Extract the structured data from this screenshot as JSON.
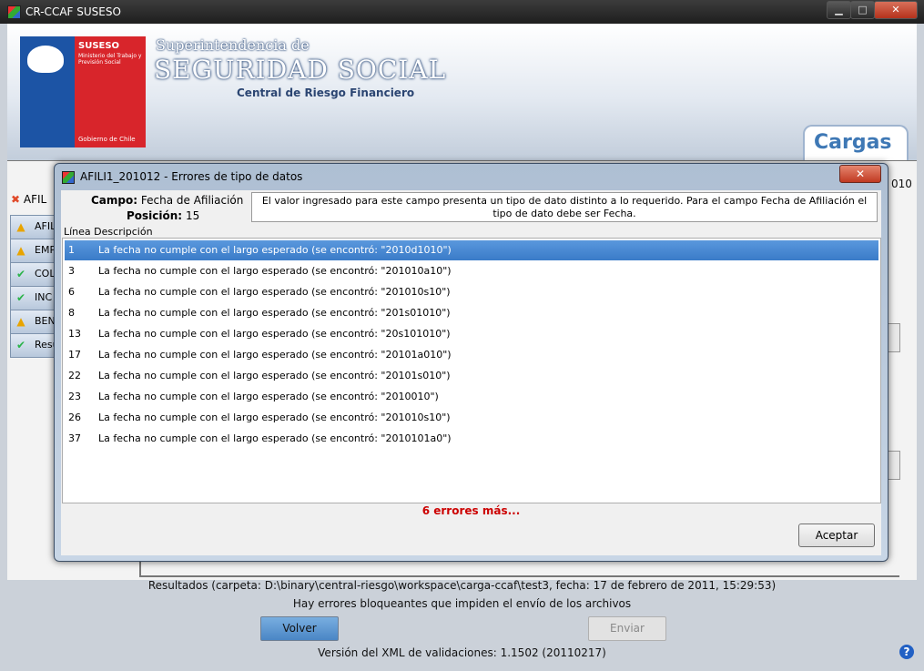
{
  "window": {
    "title": "CR-CCAF SUSESO",
    "minimize": "▁",
    "maximize": "□",
    "close": "✕"
  },
  "logo": {
    "name": "SUSESO",
    "sub": "Ministerio del Trabajo y Previsión Social",
    "footer": "Gobierno de Chile"
  },
  "header": {
    "line1": "Superintendencia de",
    "line2": "SEGURIDAD SOCIAL",
    "line3": "Central de Riesgo Financiero",
    "section_tab": "Cargas"
  },
  "background": {
    "file_tab": "AFIL",
    "side_tabs": [
      {
        "icon": "warning-icon",
        "label": "AFIL"
      },
      {
        "icon": "warning-icon",
        "label": "EMP"
      },
      {
        "icon": "check-icon",
        "label": "COL"
      },
      {
        "icon": "check-icon",
        "label": "INC"
      },
      {
        "icon": "warning-icon",
        "label": "BEN"
      },
      {
        "icon": "check-icon",
        "label": "Resu"
      }
    ],
    "right_frag": "010",
    "results_text": "Resultados (carpeta: D:\\binary\\central-riesgo\\workspace\\carga-ccaf\\test3, fecha: 17 de febrero de 2011, 15:29:53)",
    "errors_text": "Hay errores bloqueantes que impiden el envío de los archivos",
    "volver": "Volver",
    "enviar": "Enviar",
    "version": "Versión del XML de validaciones: 1.1502 (20110217)",
    "help": "?"
  },
  "dialog": {
    "title": "AFILI1_201012 - Errores de tipo de datos",
    "close": "✕",
    "campo_label": "Campo:",
    "campo_value": "Fecha de Afiliación",
    "posicion_label": "Posición:",
    "posicion_value": "15",
    "message": "El valor ingresado para este campo presenta un tipo de dato distinto a lo requerido. Para el campo Fecha de Afiliación el tipo de dato debe ser Fecha.",
    "col_linea": "Línea",
    "col_descripcion": "Descripción",
    "rows": [
      {
        "linea": "1",
        "desc": "La fecha no cumple con el largo esperado (se encontró: \"2010d1010\")"
      },
      {
        "linea": "3",
        "desc": "La fecha no cumple con el largo esperado (se encontró: \"201010a10\")"
      },
      {
        "linea": "6",
        "desc": "La fecha no cumple con el largo esperado (se encontró: \"201010s10\")"
      },
      {
        "linea": "8",
        "desc": "La fecha no cumple con el largo esperado (se encontró: \"201s01010\")"
      },
      {
        "linea": "13",
        "desc": "La fecha no cumple con el largo esperado (se encontró: \"20s101010\")"
      },
      {
        "linea": "17",
        "desc": "La fecha no cumple con el largo esperado (se encontró: \"20101a010\")"
      },
      {
        "linea": "22",
        "desc": "La fecha no cumple con el largo esperado (se encontró: \"20101s010\")"
      },
      {
        "linea": "23",
        "desc": "La fecha no cumple con el largo esperado (se encontró: \"2010010\")"
      },
      {
        "linea": "26",
        "desc": "La fecha no cumple con el largo esperado (se encontró: \"201010s10\")"
      },
      {
        "linea": "37",
        "desc": "La fecha no cumple con el largo esperado (se encontró: \"2010101a0\")"
      }
    ],
    "more": "6 errores más...",
    "accept": "Aceptar"
  }
}
